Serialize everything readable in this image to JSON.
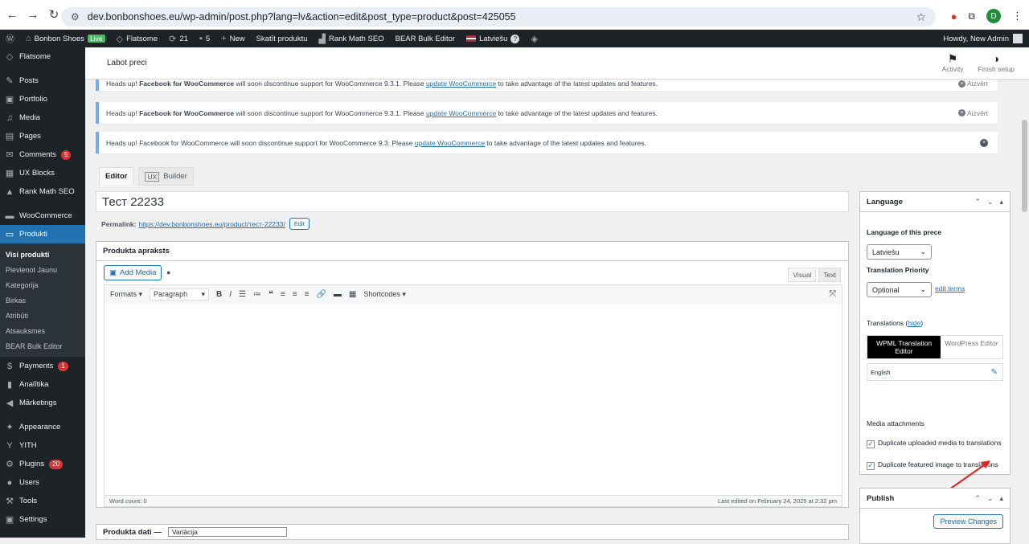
{
  "browser": {
    "url": "dev.bonbonshoes.eu/wp-admin/post.php?lang=lv&action=edit&post_type=product&post=425055",
    "profile_initial": "D"
  },
  "adminbar": {
    "site": "Bonbon Shoes",
    "live": "Live",
    "flatsome": "Flatsome",
    "updates": "21",
    "comments": "5",
    "new": "New",
    "view": "Skatīt produktu",
    "rankmath": "Rank Math SEO",
    "bear": "BEAR Bulk Editor",
    "lang": "Latviešu",
    "howdy": "Howdy, New Admin"
  },
  "sidebar": {
    "items_top": [
      {
        "icon": "◇",
        "label": "Flatsome"
      }
    ],
    "items_a": [
      {
        "icon": "✎",
        "label": "Posts"
      },
      {
        "icon": "▣",
        "label": "Portfolio"
      },
      {
        "icon": "♫",
        "label": "Media"
      },
      {
        "icon": "▤",
        "label": "Pages"
      },
      {
        "icon": "✉",
        "label": "Comments",
        "count": "5"
      },
      {
        "icon": "▦",
        "label": "UX Blocks"
      },
      {
        "icon": "▲",
        "label": "Rank Math SEO"
      }
    ],
    "woo": "WooCommerce",
    "produkti": "Produkti",
    "sub": [
      "Visi produkti",
      "Pievienot Jaunu",
      "Kategorija",
      "Birkas",
      "Atribūti",
      "Atsauksmes",
      "BEAR Bulk Editor"
    ],
    "items_b": [
      {
        "icon": "$",
        "label": "Payments",
        "count": "1"
      },
      {
        "icon": "▮",
        "label": "Analītika"
      },
      {
        "icon": "◀",
        "label": "Mārketings"
      }
    ],
    "items_c": [
      {
        "icon": "✦",
        "label": "Appearance"
      },
      {
        "icon": "Y",
        "label": "YITH"
      },
      {
        "icon": "⚙",
        "label": "Plugins",
        "count": "20"
      },
      {
        "icon": "●",
        "label": "Users"
      },
      {
        "icon": "⚒",
        "label": "Tools"
      },
      {
        "icon": "▣",
        "label": "Settings"
      }
    ]
  },
  "header": {
    "title": "Labot preci",
    "activity": "Activity",
    "finish": "Finish setup"
  },
  "notices": [
    {
      "pre": "Heads up! ",
      "bold": "Facebook for WooCommerce",
      "mid": " will soon discontinue support for WooCommerce 9.3.1. Please ",
      "link": "update WooCommerce",
      "post": " to take advantage of the latest updates and features.",
      "dismiss": "Aizvērt"
    },
    {
      "pre": "Heads up! ",
      "bold": "Facebook for WooCommerce",
      "mid": " will soon discontinue support for WooCommerce 9.3.1. Please ",
      "link": "update WooCommerce",
      "post": " to take advantage of the latest updates and features.",
      "dismiss": "Aizvērt"
    },
    {
      "pre": "Heads up! Facebook for WooCommerce will soon discontinue support for WooCommerce 9.3. Please ",
      "link": "update WooCommerce",
      "post": " to take advantage of the latest updates and features."
    }
  ],
  "editor": {
    "tab_editor": "Editor",
    "tab_ux": "UX",
    "tab_builder": "Builder",
    "title": "Тест 22233",
    "permalink_label": "Permalink:",
    "permalink": "https://dev.bonbonshoes.eu/product/тест-22233/",
    "edit": "Edit",
    "box_title": "Produkta apraksts",
    "add_media": "Add Media",
    "visual": "Visual",
    "text": "Text",
    "formats": "Formats",
    "paragraph": "Paragraph",
    "shortcodes": "Shortcodes",
    "word_count": "Word count: 0",
    "last_edited": "Last edited on February 24, 2025 at 2:32 pm",
    "product_data": "Produkta dati —",
    "product_type": "Variācija"
  },
  "language": {
    "title": "Language",
    "lang_label": "Language of this prece",
    "lang_value": "Latviešu",
    "priority_label": "Translation Priority",
    "priority_value": "Optional",
    "edit_terms": "edit terms",
    "translations": "Translations (",
    "hide": "hide",
    "close_paren": ")",
    "wpml": "WPML Translation Editor",
    "wp_editor": "WordPress Editor",
    "english": "English",
    "media_att": "Media attachments",
    "dup1": "Duplicate uploaded media to translations",
    "dup2": "Duplicate featured image to translations"
  },
  "publish": {
    "title": "Publish",
    "preview": "Preview Changes"
  },
  "colors": {
    "accent": "#2271b1",
    "admin_dark": "#1d2327",
    "active": "#2271b1",
    "arrow": "#e02424"
  }
}
